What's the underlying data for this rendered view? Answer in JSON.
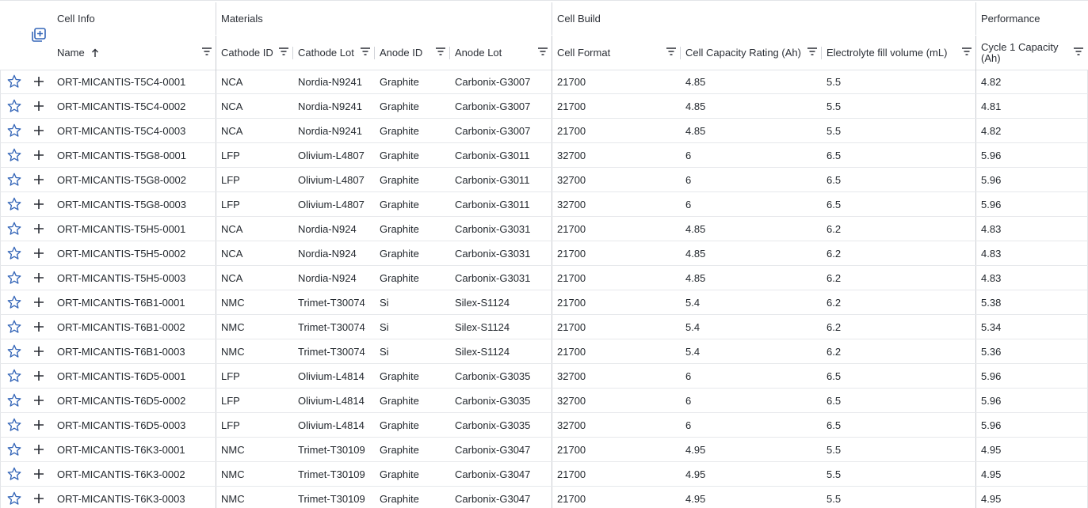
{
  "groups": [
    "Cell Info",
    "Materials",
    "Cell Build",
    "Performance"
  ],
  "columns": [
    {
      "label": "Name",
      "sorted": "ascending"
    },
    {
      "label": "Cathode ID"
    },
    {
      "label": "Cathode Lot"
    },
    {
      "label": "Anode ID"
    },
    {
      "label": "Anode Lot"
    },
    {
      "label": "Cell Format"
    },
    {
      "label": "Cell Capacity Rating (Ah)"
    },
    {
      "label": "Electrolyte fill volume (mL)"
    },
    {
      "label": "Cycle 1 Capacity (Ah)"
    }
  ],
  "rows": [
    [
      "ORT-MICANTIS-T5C4-0001",
      "NCA",
      "Nordia-N9241",
      "Graphite",
      "Carbonix-G3007",
      "21700",
      "4.85",
      "5.5",
      "4.82"
    ],
    [
      "ORT-MICANTIS-T5C4-0002",
      "NCA",
      "Nordia-N9241",
      "Graphite",
      "Carbonix-G3007",
      "21700",
      "4.85",
      "5.5",
      "4.81"
    ],
    [
      "ORT-MICANTIS-T5C4-0003",
      "NCA",
      "Nordia-N9241",
      "Graphite",
      "Carbonix-G3007",
      "21700",
      "4.85",
      "5.5",
      "4.82"
    ],
    [
      "ORT-MICANTIS-T5G8-0001",
      "LFP",
      "Olivium-L4807",
      "Graphite",
      "Carbonix-G3011",
      "32700",
      "6",
      "6.5",
      "5.96"
    ],
    [
      "ORT-MICANTIS-T5G8-0002",
      "LFP",
      "Olivium-L4807",
      "Graphite",
      "Carbonix-G3011",
      "32700",
      "6",
      "6.5",
      "5.96"
    ],
    [
      "ORT-MICANTIS-T5G8-0003",
      "LFP",
      "Olivium-L4807",
      "Graphite",
      "Carbonix-G3011",
      "32700",
      "6",
      "6.5",
      "5.96"
    ],
    [
      "ORT-MICANTIS-T5H5-0001",
      "NCA",
      "Nordia-N924",
      "Graphite",
      "Carbonix-G3031",
      "21700",
      "4.85",
      "6.2",
      "4.83"
    ],
    [
      "ORT-MICANTIS-T5H5-0002",
      "NCA",
      "Nordia-N924",
      "Graphite",
      "Carbonix-G3031",
      "21700",
      "4.85",
      "6.2",
      "4.83"
    ],
    [
      "ORT-MICANTIS-T5H5-0003",
      "NCA",
      "Nordia-N924",
      "Graphite",
      "Carbonix-G3031",
      "21700",
      "4.85",
      "6.2",
      "4.83"
    ],
    [
      "ORT-MICANTIS-T6B1-0001",
      "NMC",
      "Trimet-T30074",
      "Si",
      "Silex-S1124",
      "21700",
      "5.4",
      "6.2",
      "5.38"
    ],
    [
      "ORT-MICANTIS-T6B1-0002",
      "NMC",
      "Trimet-T30074",
      "Si",
      "Silex-S1124",
      "21700",
      "5.4",
      "6.2",
      "5.34"
    ],
    [
      "ORT-MICANTIS-T6B1-0003",
      "NMC",
      "Trimet-T30074",
      "Si",
      "Silex-S1124",
      "21700",
      "5.4",
      "6.2",
      "5.36"
    ],
    [
      "ORT-MICANTIS-T6D5-0001",
      "LFP",
      "Olivium-L4814",
      "Graphite",
      "Carbonix-G3035",
      "32700",
      "6",
      "6.5",
      "5.96"
    ],
    [
      "ORT-MICANTIS-T6D5-0002",
      "LFP",
      "Olivium-L4814",
      "Graphite",
      "Carbonix-G3035",
      "32700",
      "6",
      "6.5",
      "5.96"
    ],
    [
      "ORT-MICANTIS-T6D5-0003",
      "LFP",
      "Olivium-L4814",
      "Graphite",
      "Carbonix-G3035",
      "32700",
      "6",
      "6.5",
      "5.96"
    ],
    [
      "ORT-MICANTIS-T6K3-0001",
      "NMC",
      "Trimet-T30109",
      "Graphite",
      "Carbonix-G3047",
      "21700",
      "4.95",
      "5.5",
      "4.95"
    ],
    [
      "ORT-MICANTIS-T6K3-0002",
      "NMC",
      "Trimet-T30109",
      "Graphite",
      "Carbonix-G3047",
      "21700",
      "4.95",
      "5.5",
      "4.95"
    ],
    [
      "ORT-MICANTIS-T6K3-0003",
      "NMC",
      "Trimet-T30109",
      "Graphite",
      "Carbonix-G3047",
      "21700",
      "4.95",
      "5.5",
      "4.95"
    ]
  ],
  "icons": {
    "row_favorite": "star-outline-icon",
    "row_add": "plus-icon",
    "column_filter": "filter-lines-icon",
    "add_group": "add-to-collection-icon",
    "sort": "arrow-up-icon"
  },
  "colors": {
    "accent": "#3566b8",
    "grid_line": "#e2e4e8",
    "text": "#24292f"
  }
}
